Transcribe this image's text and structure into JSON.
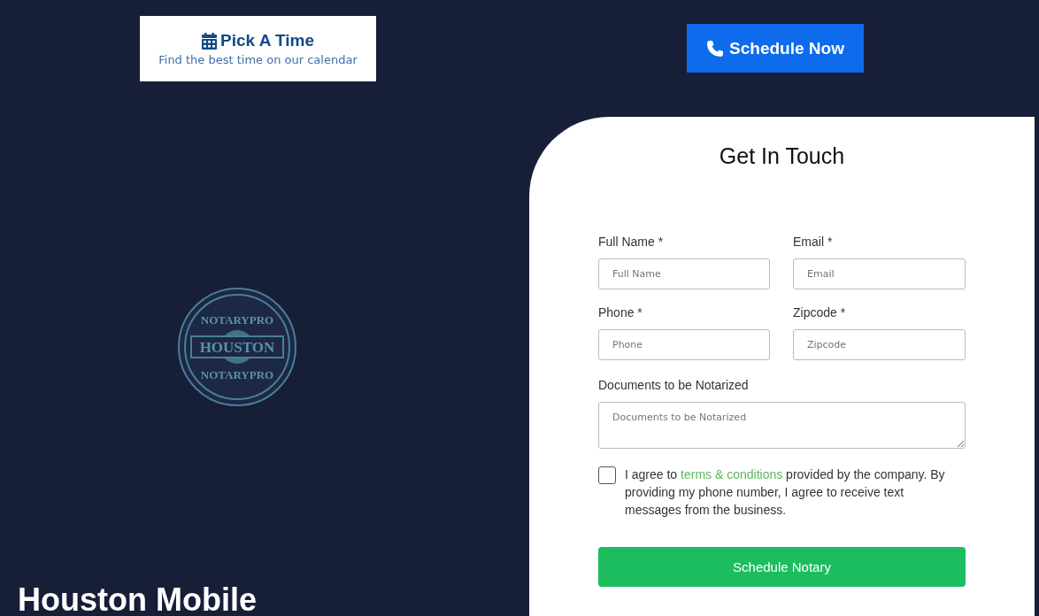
{
  "pick_time": {
    "title": "Pick A Time",
    "subtitle": "Find the best time on our calendar"
  },
  "logo": {
    "top": "NOTARYPRO",
    "middle": "HOUSTON",
    "bottom": "NOTARYPRO"
  },
  "heading": "Houston Mobile",
  "schedule_button": "Schedule Now",
  "form": {
    "title": "Get In Touch",
    "fields": [
      {
        "kind": "input",
        "label": "Full Name *",
        "placeholder": "Full Name"
      },
      {
        "kind": "input",
        "label": "Email *",
        "placeholder": "Email"
      },
      {
        "kind": "input",
        "label": "Phone *",
        "placeholder": "Phone"
      },
      {
        "kind": "input",
        "label": "Zipcode *",
        "placeholder": "Zipcode"
      },
      {
        "kind": "textarea",
        "label": "Documents to be Notarized",
        "placeholder": "Documents to be Notarized"
      }
    ],
    "consent": {
      "checked": false,
      "before": "I agree to",
      "link": "terms & conditions",
      "after": "provided by the company. By providing my phone number, I agree to receive text messages from the business."
    },
    "submit": "Schedule Notary"
  }
}
